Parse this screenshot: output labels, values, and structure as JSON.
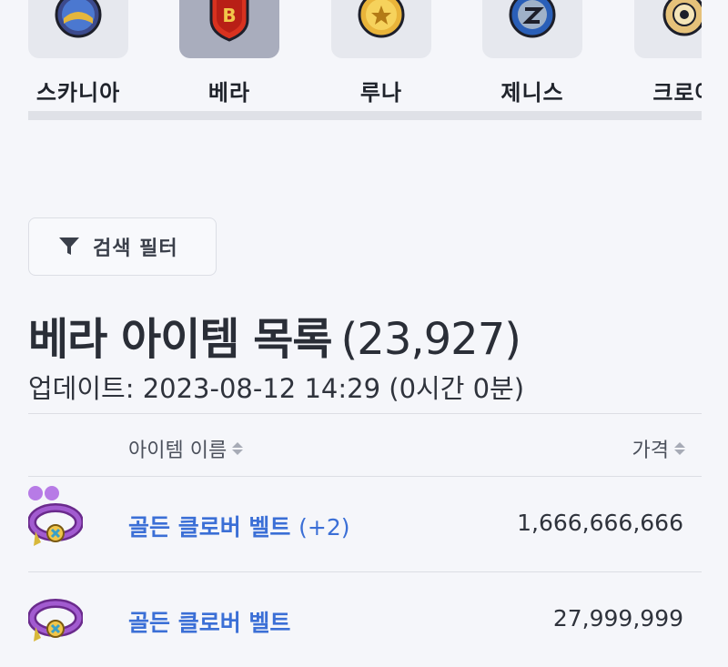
{
  "worlds": [
    {
      "label": "스카니아",
      "emblem": "globe-emblem-icon"
    },
    {
      "label": "베라",
      "emblem": "shield-emblem-icon",
      "active": true
    },
    {
      "label": "루나",
      "emblem": "moon-coin-emblem-icon"
    },
    {
      "label": "제니스",
      "emblem": "z-orb-emblem-icon"
    },
    {
      "label": "크로아",
      "emblem": "eye-emblem-icon"
    }
  ],
  "filter": {
    "label": "검색 필터",
    "icon": "filter-icon"
  },
  "heading": {
    "title": "베라 아이템 목록",
    "count": "(23,927)"
  },
  "updated": "업데이트: 2023-08-12 14:29 (0시간 0분)",
  "table": {
    "columns": {
      "name": "아이템 이름",
      "price": "가격"
    },
    "rows": [
      {
        "name": "골든 클로버 벨트",
        "suffix": "(+2)",
        "price": "1,666,666,666",
        "icon": "golden-clover-belt-icon",
        "stars": 2
      },
      {
        "name": "골든 클로버 벨트",
        "suffix": "",
        "price": "27,999,999",
        "icon": "golden-clover-belt-icon",
        "stars": 0
      }
    ]
  },
  "colors": {
    "accent": "#3b6fd6",
    "active_tile": "#a9adbd",
    "star": "#b77be6"
  }
}
